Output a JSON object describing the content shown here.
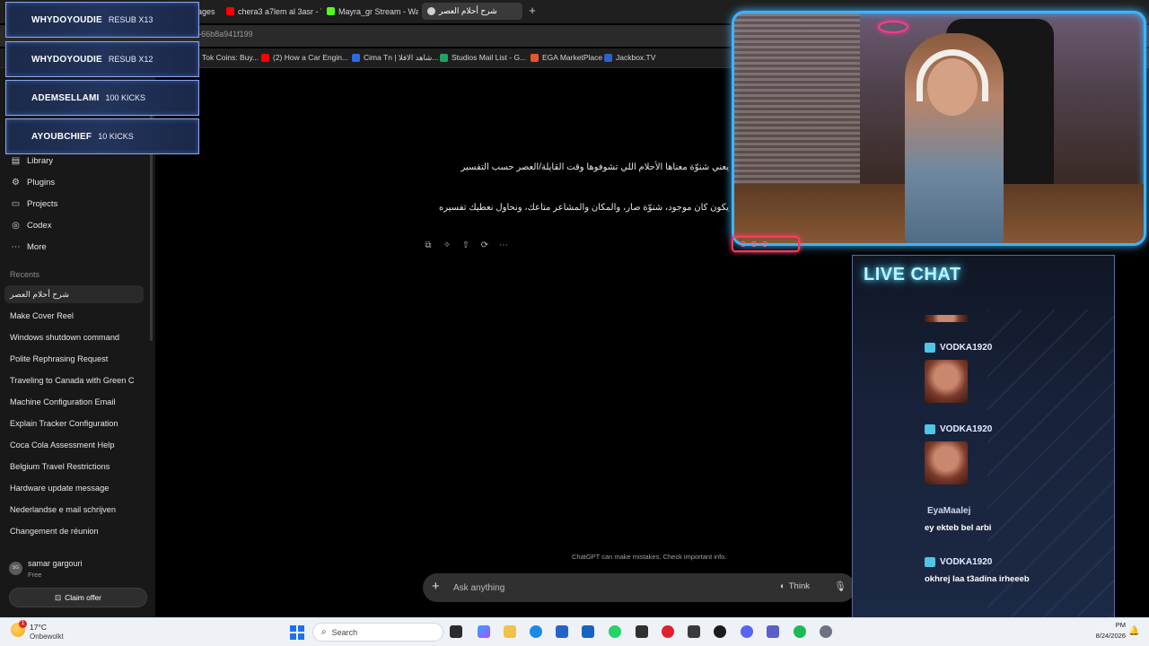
{
  "browser": {
    "tabs": [
      {
        "label": "ages",
        "color": "#8a8a8a"
      },
      {
        "label": "chera3 a7lem al 3asr - You",
        "color": "#ff0000"
      },
      {
        "label": "Mayra_gr Stream - Watch",
        "color": "#53fc18"
      },
      {
        "label": "شرح أحلام العصر",
        "color": "#cfcfcf",
        "active": true
      }
    ],
    "url": "a8a00ac-69ad-4ec4-66eb-b4cc-66b8a941f199",
    "bookmarks": [
      {
        "label": "Tok Coins: Buy...",
        "color": "#1e1e1e"
      },
      {
        "label": "(2) How a Car Engin...",
        "color": "#ff0000"
      },
      {
        "label": "Cima Tn | شاهد الافلا...",
        "color": "#2d6cdf"
      },
      {
        "label": "Studios Mail List - G...",
        "color": "#21a366"
      },
      {
        "label": "EGA MarketPlace",
        "color": "#e8552b"
      },
      {
        "label": "Jackbox.TV",
        "color": "#2f5fd0"
      }
    ]
  },
  "sidebar": {
    "nav": [
      {
        "label": "Library",
        "icon": "library-icon",
        "glyph": "▤"
      },
      {
        "label": "Plugins",
        "icon": "plugins-icon",
        "glyph": "⚙"
      },
      {
        "label": "Projects",
        "icon": "projects-icon",
        "glyph": "▭"
      },
      {
        "label": "Codex",
        "icon": "codex-icon",
        "glyph": "◎"
      },
      {
        "label": "More",
        "icon": "more-icon",
        "glyph": "⋯"
      }
    ],
    "recents_label": "Recents",
    "recents": [
      "شرح أحلام العصر",
      "Make Cover Reel",
      "Windows shutdown command",
      "Polite Rephrasing Request",
      "Traveling to Canada with Green C",
      "Machine Configuration Email",
      "Explain Tracker Configuration",
      "Coca Cola Assessment Help",
      "Belgium Travel Restrictions",
      "Hardware update message",
      "Nederlandse e mail schrijven",
      "Changement de réunion"
    ],
    "user": {
      "initials": "SG",
      "name": "samar gargouri",
      "plan": "Free"
    },
    "claim_label": "Claim offer"
  },
  "main": {
    "messages": [
      "يعني شنوّة معناها الأحلام اللي تشوفوها وقت القايلة/العصر حسب التفسير",
      "يكون كان موجود، شنوّة صار، والمكان والمشاعر متاعك، ونحاول نعطيك تفسيره"
    ],
    "disclaimer": "ChatGPT can make mistakes. Check important info.",
    "composer": {
      "placeholder": "Ask anything",
      "think_label": "Think"
    }
  },
  "stream": {
    "sub_alerts": [
      {
        "name": "WHYDOYOUDIE",
        "value": "RESUB X13"
      },
      {
        "name": "WHYDOYOUDIE",
        "value": "RESUB X12"
      },
      {
        "name": "ADEMSELLAMI",
        "value": "100 KICKS"
      },
      {
        "name": "AYOUBCHIEF",
        "value": "10 KICKS"
      }
    ],
    "chat_title": "LIVE CHAT",
    "chat": {
      "user1": "VODKA1920",
      "user2": "VODKA1920",
      "user3": "EyaMaalej",
      "msg3": "ey ekteb bel arbi",
      "user4": "VODKA1920",
      "msg4": "okhrej laa t3adina irheeeb"
    },
    "colors": {
      "frame": "#3fb4ff",
      "badge": "#ff3a5e",
      "chat_title_glow": "#47d4ff"
    }
  },
  "taskbar": {
    "weather": {
      "temp": "17°C",
      "desc": "Onbewolkt",
      "badge": "1"
    },
    "search_label": "Search",
    "time": "PM",
    "date": "8/24/2026"
  }
}
